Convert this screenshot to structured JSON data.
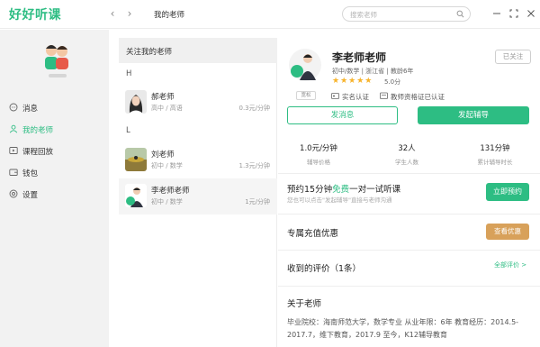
{
  "app": {
    "logo": "好好听课"
  },
  "header": {
    "breadcrumb": "我的老师",
    "search_placeholder": "搜索老师"
  },
  "sidebar": {
    "items": [
      {
        "label": "消息",
        "icon": "message-icon"
      },
      {
        "label": "我的老师",
        "icon": "teacher-icon",
        "active": true
      },
      {
        "label": "课程回放",
        "icon": "playback-icon"
      },
      {
        "label": "钱包",
        "icon": "wallet-icon"
      },
      {
        "label": "设置",
        "icon": "settings-icon"
      }
    ]
  },
  "teacher_list": {
    "header": "关注我的老师",
    "groups": [
      {
        "letter": "H",
        "teachers": [
          {
            "name": "郝老师",
            "sub": "高中 / 高语",
            "price": "0.3元/分钟"
          }
        ]
      },
      {
        "letter": "L",
        "teachers": [
          {
            "name": "刘老师",
            "sub": "初中 / 数学",
            "price": "1.3元/分钟"
          },
          {
            "name": "李老师老师",
            "sub": "初中 / 数学",
            "price": "1元/分钟"
          }
        ]
      }
    ]
  },
  "detail": {
    "name": "李老师老师",
    "meta": "初中/数学 | 浙江省 | 教龄6年",
    "rating": "5.0分",
    "tag": "宽松",
    "cert_real_name": "实名认证",
    "cert_qualification": "教师资格证已认证",
    "follow_state": "已关注",
    "btn_message": "发消息",
    "btn_tutor": "发起辅导",
    "stats": [
      {
        "value": "1.0元/分钟",
        "label": "辅导价格"
      },
      {
        "value": "32人",
        "label": "学生人数"
      },
      {
        "value": "131分钟",
        "label": "累计辅导时长"
      }
    ],
    "trial": {
      "title_prefix": "预约15分钟",
      "title_free": "免费",
      "title_suffix": "一对一试听课",
      "subtitle": "您也可以点击\"发起辅导\"直接与老师沟通",
      "button": "立即预约"
    },
    "recharge": {
      "title": "专属充值优惠",
      "button": "查看优惠"
    },
    "reviews": {
      "title": "收到的评价（1条）",
      "link": "全部评价 >"
    },
    "about": {
      "title": "关于老师",
      "text": "毕业院校：海南师范大学，数学专业 从业年限：6年 教育经历：2014.5-2017.7，维下教育，2017.9 至今，K12辅导教育"
    }
  },
  "colors": {
    "accent": "#2dbd83",
    "gold": "#d8a15a",
    "star": "#f7b32b"
  }
}
